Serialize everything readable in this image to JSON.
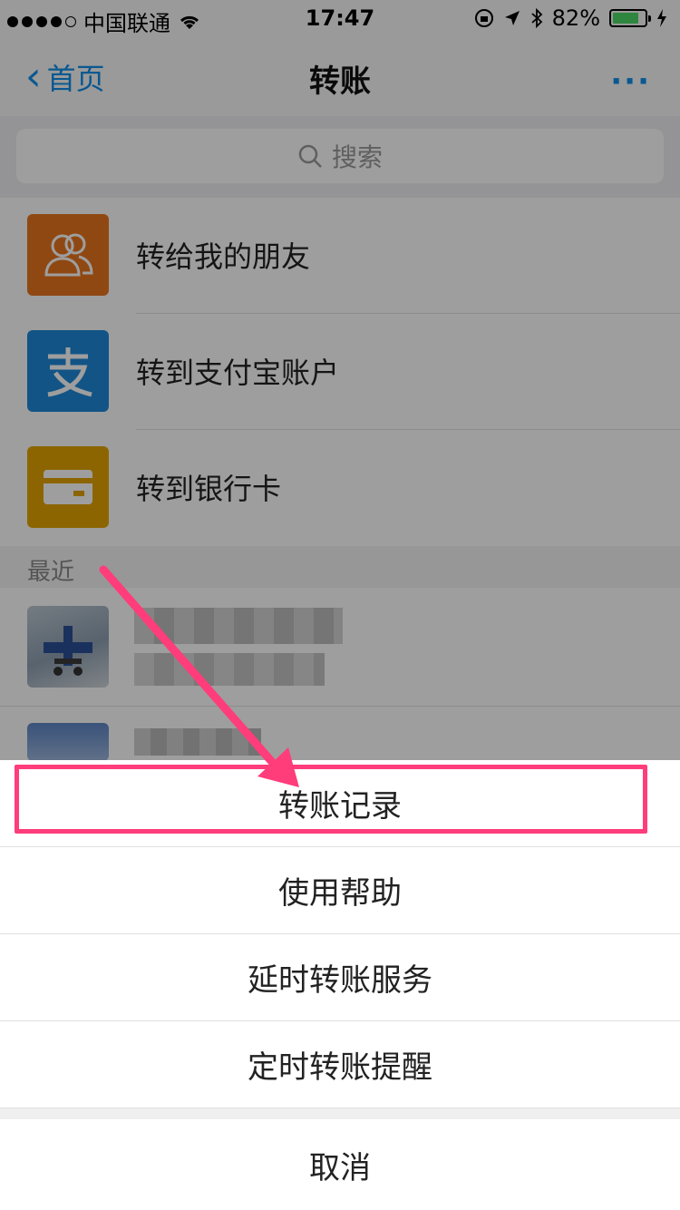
{
  "status_bar": {
    "carrier": "中国联通",
    "time": "17:47",
    "battery": "82%",
    "battery_level": 0.82
  },
  "nav": {
    "back_label": "首页",
    "title": "转账",
    "more_label": "···"
  },
  "search": {
    "placeholder": "搜索"
  },
  "transfer_options": [
    {
      "label": "转给我的朋友",
      "color": "#e8741e",
      "icon": "friends-icon"
    },
    {
      "label": "转到支付宝账户",
      "color": "#1e88d8",
      "icon": "alipay-icon"
    },
    {
      "label": "转到银行卡",
      "color": "#e3a300",
      "icon": "bank-card-icon"
    }
  ],
  "recent": {
    "header": "最近"
  },
  "action_sheet": {
    "items": [
      "转账记录",
      "使用帮助",
      "延时转账服务",
      "定时转账提醒"
    ],
    "cancel": "取消"
  },
  "colors": {
    "accent": "#108ee9",
    "highlight": "#ff3d7b"
  }
}
